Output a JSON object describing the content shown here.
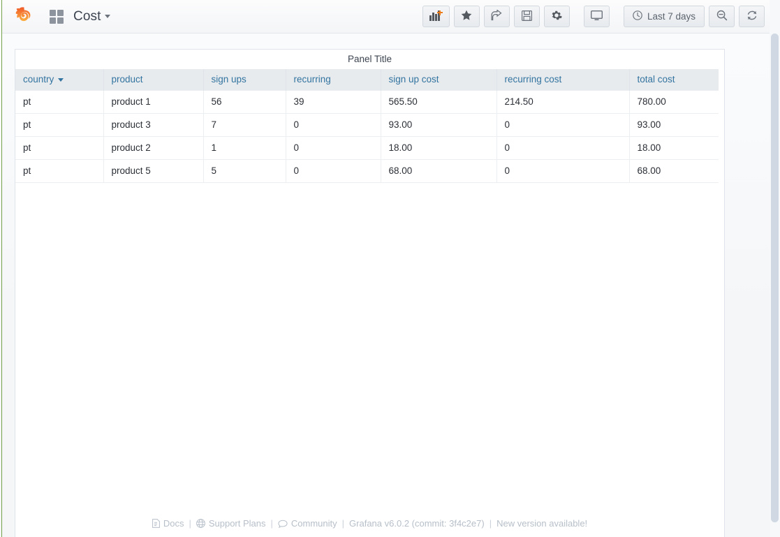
{
  "navbar": {
    "dashboard_title": "Cost",
    "grid_icon": "grid-icon",
    "logo_icon": "grafana-logo-icon",
    "caret_icon": "chevron-down-icon",
    "buttons": [
      {
        "name": "add-panel-button",
        "icon": "add-panel-icon",
        "label": ""
      },
      {
        "name": "star-dashboard-button",
        "icon": "star-icon",
        "label": ""
      },
      {
        "name": "share-dashboard-button",
        "icon": "share-icon",
        "label": ""
      },
      {
        "name": "save-dashboard-button",
        "icon": "save-icon",
        "label": ""
      },
      {
        "name": "dashboard-settings-button",
        "icon": "gear-icon",
        "label": ""
      },
      {
        "name": "cycle-view-mode-button",
        "icon": "monitor-icon",
        "label": ""
      }
    ],
    "time_picker": {
      "label": "Last 7 days",
      "icon": "clock-icon"
    },
    "zoom_out_button": {
      "label": "",
      "icon": "search-minus-icon"
    },
    "refresh_button": {
      "label": "",
      "icon": "refresh-icon"
    }
  },
  "panel": {
    "title": "Panel Title",
    "table": {
      "columns": [
        {
          "label": "country",
          "sorted": true,
          "sort_dir": "desc"
        },
        {
          "label": "product",
          "sorted": false
        },
        {
          "label": "sign ups",
          "sorted": false
        },
        {
          "label": "recurring",
          "sorted": false
        },
        {
          "label": "sign up cost",
          "sorted": false
        },
        {
          "label": "recurring cost",
          "sorted": false
        },
        {
          "label": "total cost",
          "sorted": false
        }
      ],
      "rows": [
        [
          "pt",
          "product 1",
          "56",
          "39",
          "565.50",
          "214.50",
          "780.00"
        ],
        [
          "pt",
          "product 3",
          "7",
          "0",
          "93.00",
          "0",
          "93.00"
        ],
        [
          "pt",
          "product 2",
          "1",
          "0",
          "18.00",
          "0",
          "18.00"
        ],
        [
          "pt",
          "product 5",
          "5",
          "0",
          "68.00",
          "0",
          "68.00"
        ]
      ]
    }
  },
  "footer": {
    "docs": "Docs",
    "support": "Support Plans",
    "community": "Community",
    "version": "Grafana v6.0.2 (commit: 3f4c2e7)",
    "new_version": "New version available!",
    "separator": "|"
  },
  "colors": {
    "accent_orange": "#eb7b18",
    "header_text": "#3274a0",
    "page_bg": "#f7f8fa",
    "panel_bg": "#ffffff",
    "table_header_bg": "#e8ebee"
  }
}
